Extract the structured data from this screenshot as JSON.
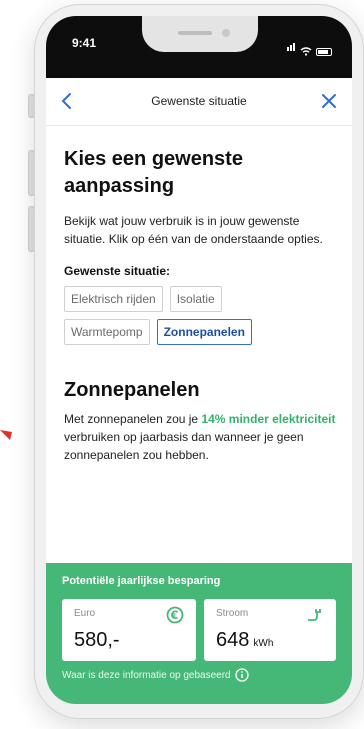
{
  "status_bar": {
    "time": "9:41"
  },
  "nav": {
    "title": "Gewenste situatie"
  },
  "intro": {
    "heading": "Kies een gewenste aanpassing",
    "text": "Bekijk wat jouw verbruik is in jouw gewenste situatie. Klik op één van de onderstaande opties."
  },
  "situation": {
    "label": "Gewenste situatie:",
    "options": [
      "Elektrisch rijden",
      "Isolatie",
      "Warmtepomp",
      "Zonnepanelen"
    ],
    "selected": "Zonnepanelen"
  },
  "detail": {
    "heading": "Zonnepanelen",
    "text_before": "Met zonnepanelen zou je ",
    "highlight": "14% minder elektriciteit",
    "text_after": " verbruiken op jaarbasis dan wanneer je geen zonnepanelen zou hebben."
  },
  "savings": {
    "title": "Potentiële jaarlijkse besparing",
    "euro": {
      "label": "Euro",
      "value": "580,-",
      "icon": "euro-icon"
    },
    "energy": {
      "label": "Stroom",
      "value": "648",
      "unit": "kWh",
      "icon": "plug-icon"
    },
    "info_link": "Waar is deze informatie op gebaseerd"
  },
  "colors": {
    "accent_green": "#45b878",
    "highlight_green": "#33b36a",
    "nav_blue": "#2f6fd1",
    "status_bar": "#0d0d0d"
  }
}
